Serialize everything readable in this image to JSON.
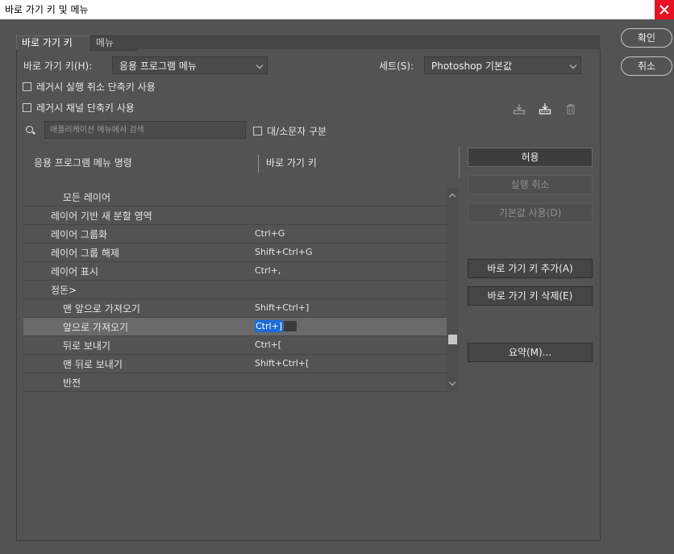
{
  "window": {
    "title": "바로 가기 키 및 메뉴"
  },
  "tabs": [
    {
      "label": "바로 가기 키"
    },
    {
      "label": "메뉴"
    }
  ],
  "shortcuts_for": {
    "label": "바로 가기 키(H):",
    "value": "응용 프로그램 메뉴"
  },
  "set": {
    "label": "세트(S):",
    "value": "Photoshop 기본값"
  },
  "options": {
    "legacy_undo": "레거시 실행 취소 단축키 사용",
    "legacy_channel": "레거시 채널 단축키 사용",
    "match_case": "대/소문자 구분"
  },
  "search": {
    "placeholder": "애플리케이션 메뉴에서 검색"
  },
  "columns": {
    "command": "응용 프로그램 메뉴 명령",
    "shortcut": "바로 가기 키"
  },
  "rows": [
    {
      "name": "모든 레이어",
      "shortcut": ""
    },
    {
      "name": "레이어 기반 새 분할 영역",
      "shortcut": ""
    },
    {
      "name": "레이어 그룹화",
      "shortcut": "Ctrl+G"
    },
    {
      "name": "레이어 그룹 해제",
      "shortcut": "Shift+Ctrl+G"
    },
    {
      "name": "레이어 표시",
      "shortcut": "Ctrl+,"
    },
    {
      "name": "정돈>",
      "shortcut": ""
    },
    {
      "name": "맨 앞으로 가져오기",
      "shortcut": "Shift+Ctrl+]"
    },
    {
      "name": "앞으로 가져오기",
      "shortcut": "Ctrl+]"
    },
    {
      "name": "뒤로 보내기",
      "shortcut": "Ctrl+["
    },
    {
      "name": "맨 뒤로 보내기",
      "shortcut": "Shift+Ctrl+["
    },
    {
      "name": "반전",
      "shortcut": ""
    }
  ],
  "buttons": {
    "accept": "허용",
    "undo": "실행 취소",
    "use_default": "기본값 사용(D)",
    "add_shortcut": "바로 가기 키 추가(A)",
    "delete_shortcut": "바로 가기 키 삭제(E)",
    "summarize": "요약(M)...",
    "ok": "확인",
    "cancel": "취소"
  },
  "colors": {
    "background": "#535353",
    "selection": "#1e6ad8",
    "close": "#e81123"
  }
}
